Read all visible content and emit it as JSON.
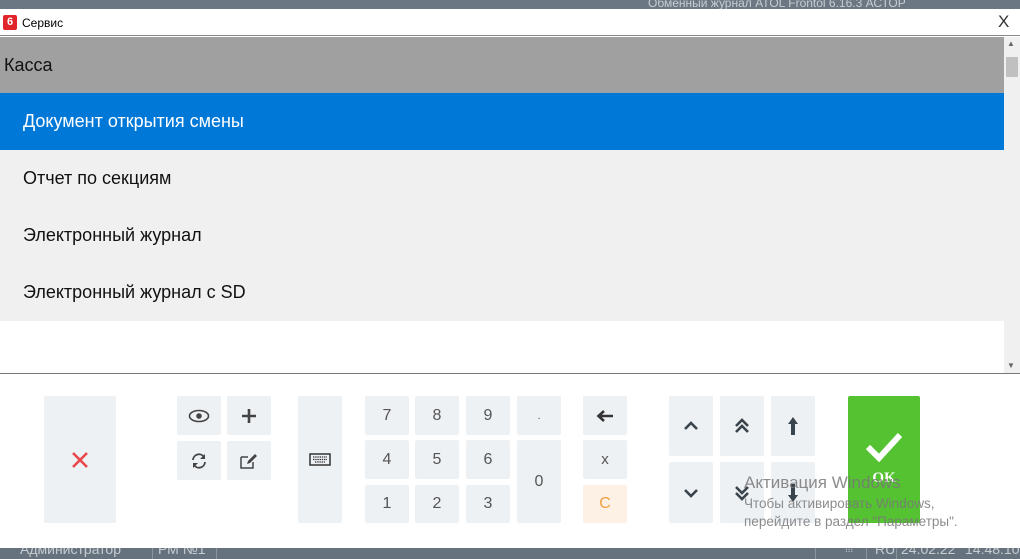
{
  "background": {
    "app_caption": "Обменный журнал   ATOL  Frontol 6.16.3 АСТОР"
  },
  "dialog": {
    "icon": "6",
    "title": "Сервис",
    "close": "X"
  },
  "list": {
    "group": "Касса",
    "selected_index": 0,
    "items": [
      "Документ открытия смены",
      "Отчет по секциям",
      "Электронный журнал",
      "Электронный журнал с SD"
    ]
  },
  "keypad": {
    "digits": [
      "7",
      "8",
      "9",
      "4",
      "5",
      "6",
      "1",
      "2",
      "3"
    ],
    "dot": ".",
    "zero": "0",
    "multiply": "x",
    "clear": "C",
    "ok": "OK"
  },
  "colors": {
    "selected": "#0078d7",
    "ok": "#55c232",
    "cancel": "#e8474c",
    "clear": "#f0a040"
  },
  "watermark": {
    "line1": "Активация Windows",
    "line2": "Чтобы активировать Windows,",
    "line3": "перейдите в раздел \"Параметры\"."
  },
  "status": {
    "user": "Администратор",
    "workplace": "РМ №1",
    "lang": "RU",
    "date": "24.02.22",
    "time": "14:48:10"
  }
}
